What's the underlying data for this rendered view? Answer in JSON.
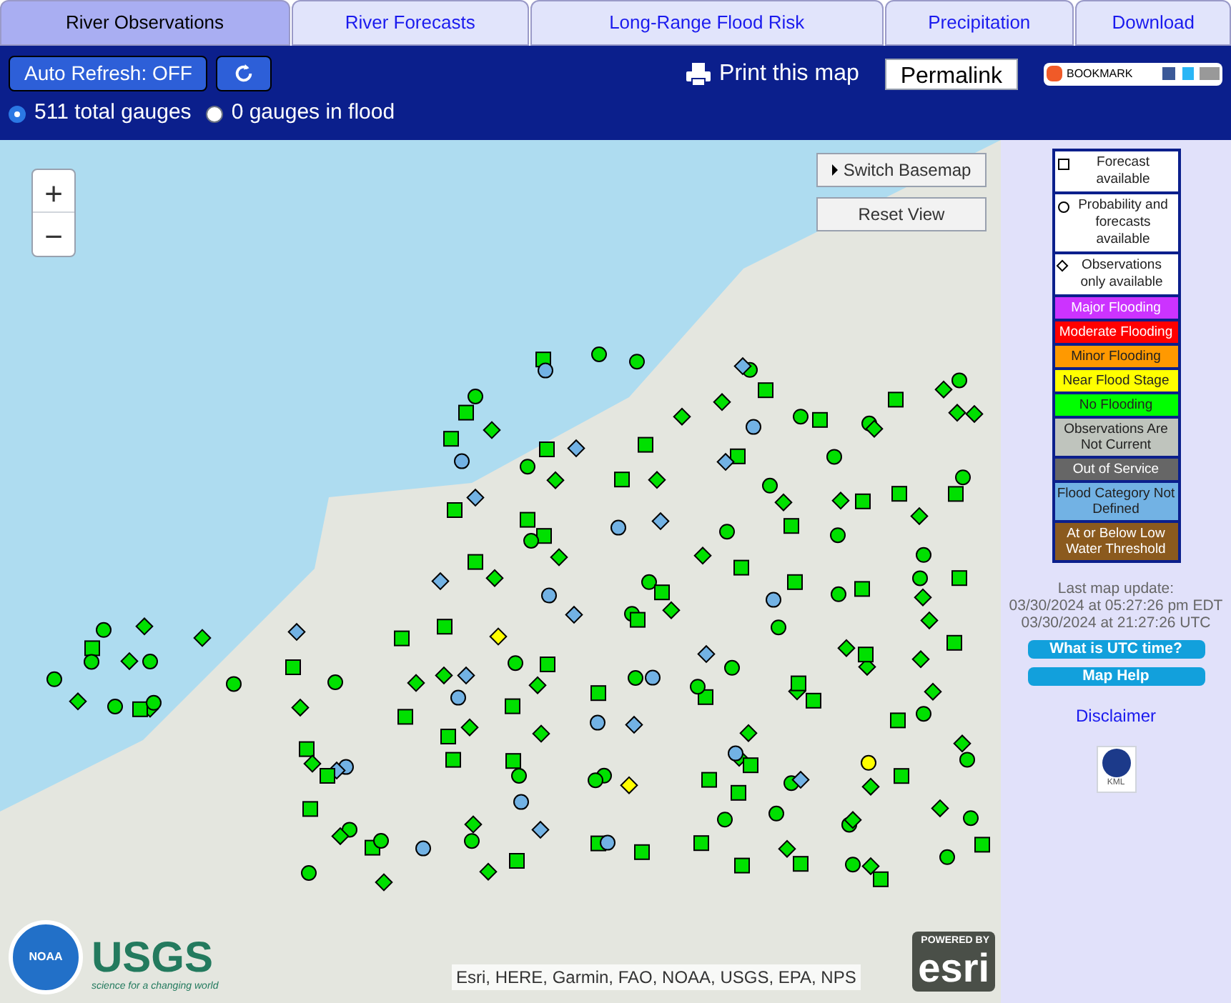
{
  "tabs": [
    {
      "label": "River Observations",
      "selected": true
    },
    {
      "label": "River Forecasts",
      "selected": false
    },
    {
      "label": "Long-Range Flood Risk",
      "selected": false
    },
    {
      "label": "Precipitation",
      "selected": false
    },
    {
      "label": "Download",
      "selected": false
    }
  ],
  "toolbar": {
    "auto_refresh": "Auto Refresh: OFF",
    "print": "Print this map",
    "permalink": "Permalink",
    "bookmark": "BOOKMARK"
  },
  "filters": [
    {
      "label": "511 total gauges",
      "selected": true
    },
    {
      "label": "0 gauges in flood",
      "selected": false
    }
  ],
  "map": {
    "switch_basemap": "Switch Basemap",
    "reset_view": "Reset View",
    "zoom_in": "+",
    "zoom_out": "−",
    "attribution": "Esri, HERE, Garmin, FAO, NOAA, USGS, EPA, NPS",
    "usgs": "USGS",
    "usgs_tagline": "science for a changing world",
    "noaa": "NOAA",
    "esri_powered": "POWERED BY",
    "esri": "esri"
  },
  "legend": [
    {
      "kind": "square",
      "label": "Forecast available"
    },
    {
      "kind": "circle",
      "label": "Probability and forecasts available"
    },
    {
      "kind": "diamond",
      "label": "Observations only available"
    },
    {
      "kind": "color",
      "label": "Major Flooding",
      "color": "#cc33ff"
    },
    {
      "kind": "color",
      "label": "Moderate Flooding",
      "color": "#ff0000"
    },
    {
      "kind": "color",
      "label": "Minor Flooding",
      "color": "#ff9900"
    },
    {
      "kind": "color",
      "label": "Near Flood Stage",
      "color": "#ffff00"
    },
    {
      "kind": "color",
      "label": "No Flooding",
      "color": "#00ff00"
    },
    {
      "kind": "color",
      "label": "Observations Are Not Current",
      "color": "#bfc4bd"
    },
    {
      "kind": "color",
      "label": "Out of Service",
      "color": "#666666"
    },
    {
      "kind": "color",
      "label": "Flood Category Not Defined",
      "color": "#72b2e4"
    },
    {
      "kind": "color",
      "label": "At or Below Low Water Threshold",
      "color": "#8b5a1e"
    }
  ],
  "update": {
    "title": "Last map update:",
    "local": "03/30/2024 at 05:27:26 pm EDT",
    "utc": "03/30/2024 at 21:27:26 UTC"
  },
  "buttons": [
    "What is UTC time?",
    "Map Help"
  ],
  "disclaimer": "Disclaimer",
  "kml": "KML"
}
